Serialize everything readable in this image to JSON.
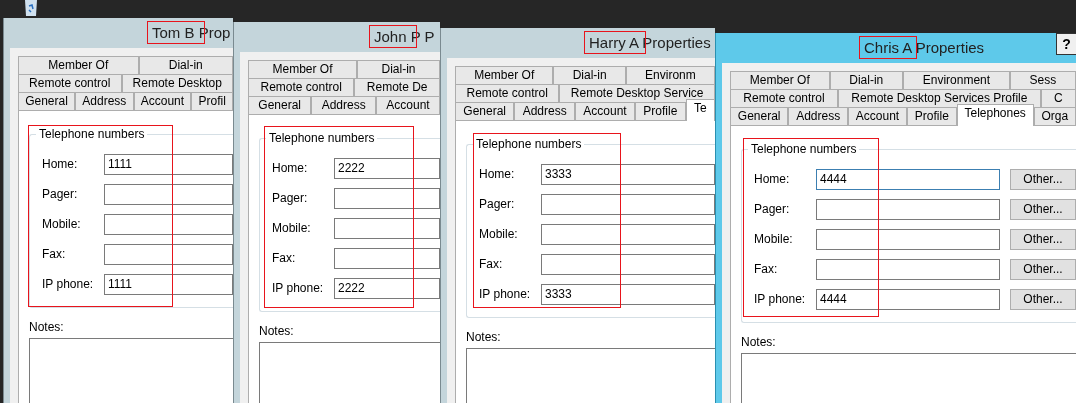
{
  "windows": [
    {
      "title": "Tom B Prop",
      "active": false,
      "tab_rows": [
        [
          {
            "label": "Member Of",
            "selected": false
          },
          {
            "label": "Dial-in",
            "selected": false
          }
        ],
        [
          {
            "label": "Remote control",
            "selected": false
          },
          {
            "label": "Remote Desktop",
            "selected": false
          }
        ],
        [
          {
            "label": "General",
            "selected": false
          },
          {
            "label": "Address",
            "selected": false
          },
          {
            "label": "Account",
            "selected": false
          },
          {
            "label": "Profil",
            "selected": false
          }
        ]
      ],
      "group_title": "Telephone numbers",
      "fields": [
        {
          "label": "Home:",
          "value": "1111",
          "focused": false
        },
        {
          "label": "Pager:",
          "focused": false
        },
        {
          "label": "Mobile:",
          "focused": false
        },
        {
          "label": "Fax:",
          "focused": false
        },
        {
          "label": "IP phone:",
          "value": "1111",
          "focused": false
        }
      ],
      "notes_label": "Notes:"
    },
    {
      "title": "John P P",
      "active": false,
      "tab_rows": [
        [
          {
            "label": "Member Of",
            "selected": false
          },
          {
            "label": "Dial-in",
            "selected": false
          }
        ],
        [
          {
            "label": "Remote control",
            "selected": false
          },
          {
            "label": "Remote De",
            "selected": false
          }
        ],
        [
          {
            "label": "General",
            "selected": false
          },
          {
            "label": "Address",
            "selected": false
          },
          {
            "label": "Account",
            "selected": false
          }
        ]
      ],
      "group_title": "Telephone numbers",
      "fields": [
        {
          "label": "Home:",
          "value": "2222",
          "focused": false
        },
        {
          "label": "Pager:",
          "focused": false
        },
        {
          "label": "Mobile:",
          "focused": false
        },
        {
          "label": "Fax:",
          "focused": false
        },
        {
          "label": "IP phone:",
          "value": "2222",
          "focused": false
        }
      ],
      "notes_label": "Notes:"
    },
    {
      "title": "Harry A Properties",
      "active": false,
      "tab_rows": [
        [
          {
            "label": "Member Of",
            "selected": false
          },
          {
            "label": "Dial-in",
            "selected": false
          },
          {
            "label": "Environm",
            "selected": false
          }
        ],
        [
          {
            "label": "Remote control",
            "selected": false
          },
          {
            "label": "Remote Desktop Service",
            "selected": false
          }
        ],
        [
          {
            "label": "General",
            "selected": false
          },
          {
            "label": "Address",
            "selected": false
          },
          {
            "label": "Account",
            "selected": false
          },
          {
            "label": "Profile",
            "selected": false
          },
          {
            "label": "Te",
            "selected": true
          }
        ]
      ],
      "group_title": "Telephone numbers",
      "fields": [
        {
          "label": "Home:",
          "value": "3333",
          "focused": false
        },
        {
          "label": "Pager:",
          "focused": false
        },
        {
          "label": "Mobile:",
          "focused": false
        },
        {
          "label": "Fax:",
          "focused": false
        },
        {
          "label": "IP phone:",
          "value": "3333",
          "focused": false
        }
      ],
      "notes_label": "Notes:"
    },
    {
      "title": "Chris A Properties",
      "active": true,
      "help_button": "?",
      "tab_rows": [
        [
          {
            "label": "Member Of",
            "selected": false
          },
          {
            "label": "Dial-in",
            "selected": false
          },
          {
            "label": "Environment",
            "selected": false
          },
          {
            "label": "Sess",
            "selected": false
          }
        ],
        [
          {
            "label": "Remote control",
            "selected": false
          },
          {
            "label": "Remote Desktop Services Profile",
            "selected": false
          },
          {
            "label": "C",
            "selected": false
          }
        ],
        [
          {
            "label": "General",
            "selected": false
          },
          {
            "label": "Address",
            "selected": false
          },
          {
            "label": "Account",
            "selected": false
          },
          {
            "label": "Profile",
            "selected": false
          },
          {
            "label": "Telephones",
            "selected": true
          },
          {
            "label": "Orga",
            "selected": false
          }
        ]
      ],
      "group_title": "Telephone numbers",
      "fields": [
        {
          "label": "Home:",
          "value": "4444",
          "focused": true,
          "button": "Other..."
        },
        {
          "label": "Pager:",
          "focused": false,
          "button": "Other..."
        },
        {
          "label": "Mobile:",
          "focused": false,
          "button": "Other..."
        },
        {
          "label": "Fax:",
          "focused": false,
          "button": "Other..."
        },
        {
          "label": "IP phone:",
          "value": "4444",
          "focused": false,
          "button": "Other..."
        }
      ],
      "notes_label": "Notes:"
    }
  ]
}
